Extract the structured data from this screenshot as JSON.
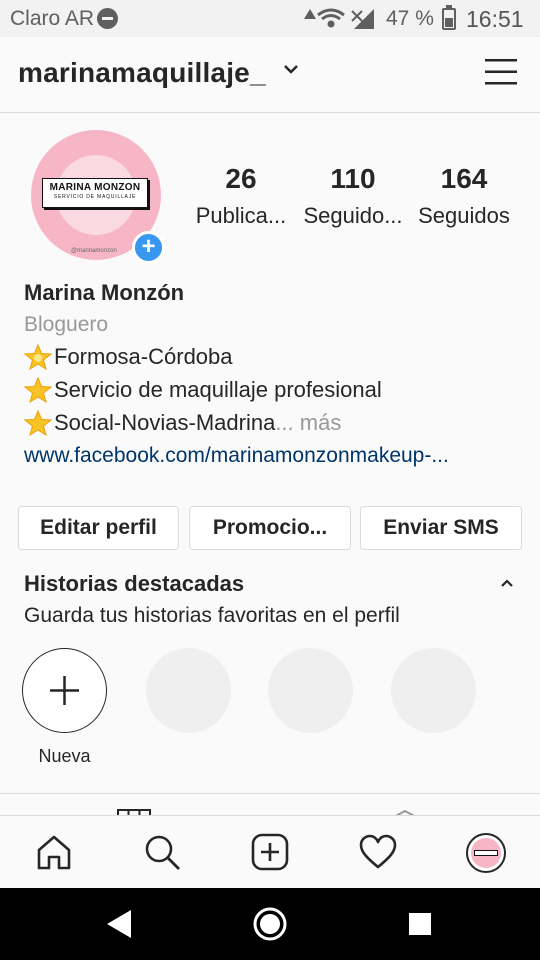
{
  "status_bar": {
    "carrier": "Claro AR",
    "battery_percent": "47 %",
    "time": "16:51",
    "icons": [
      "dnd-icon",
      "alarm-icon",
      "wifi-icon",
      "signal-icon",
      "battery-icon"
    ]
  },
  "header": {
    "username": "marinamaquillaje_",
    "icons": [
      "chevron-down-icon",
      "menu-icon"
    ]
  },
  "profile": {
    "avatar": {
      "logo_line1": "MARINA MONZON",
      "logo_line2": "SERVICIO DE MAQUILLAJE",
      "handle": "@marinamonzon"
    },
    "stats": [
      {
        "value": "26",
        "label": "Publica..."
      },
      {
        "value": "110",
        "label": "Seguido..."
      },
      {
        "value": "164",
        "label": "Seguidos"
      }
    ]
  },
  "bio": {
    "name": "Marina Monzón",
    "category": "Bloguero",
    "lines": [
      "Formosa-Córdoba",
      "Servicio de maquillaje profesional",
      "Social-Novias-Madrina"
    ],
    "more": "... más",
    "link": "www.facebook.com/marinamonzonmakeup-..."
  },
  "buttons": {
    "edit": "Editar perfil",
    "promote": "Promocio...",
    "sms": "Enviar SMS"
  },
  "highlights": {
    "title": "Historias destacadas",
    "subtitle": "Guarda tus historias favoritas en el perfil",
    "new_label": "Nueva"
  },
  "colors": {
    "accent_blue": "#3897f0",
    "link_blue": "#003569",
    "avatar_pink": "#f6b6c6"
  }
}
